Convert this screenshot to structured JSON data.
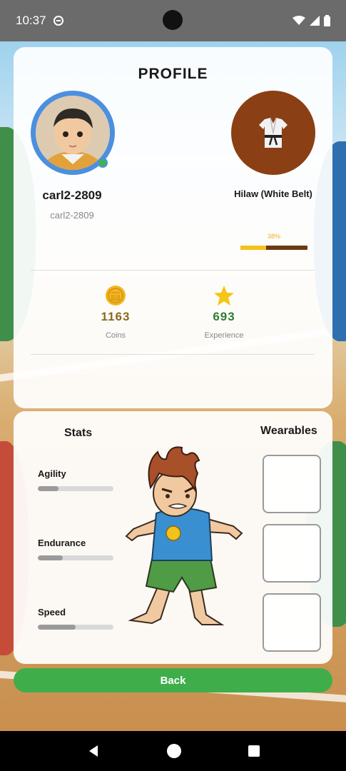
{
  "status_bar": {
    "time": "10:37"
  },
  "profile": {
    "title": "PROFILE",
    "username": "carl2-2809",
    "handle": "carl2-2809",
    "rank": "Hilaw (White Belt)",
    "rank_progress_label": "38%",
    "rank_progress_fraction": 0.38,
    "belt_color": "#8a3f14",
    "avatar_ring_color": "#4c8fe0"
  },
  "currency": {
    "coins": {
      "value": "1163",
      "label": "Coins",
      "color": "#8a6a1e",
      "icon": "coin-icon"
    },
    "experience": {
      "value": "693",
      "label": "Experience",
      "color": "#2e7d32",
      "icon": "star-icon"
    }
  },
  "stats": {
    "heading": "Stats",
    "items": [
      {
        "label": "Agility",
        "fraction": 0.27
      },
      {
        "label": "Endurance",
        "fraction": 0.33
      },
      {
        "label": "Speed",
        "fraction": 0.5
      }
    ]
  },
  "wearables": {
    "heading": "Wearables",
    "slots": 3
  },
  "actions": {
    "back_label": "Back",
    "back_color": "#3fae4a"
  }
}
